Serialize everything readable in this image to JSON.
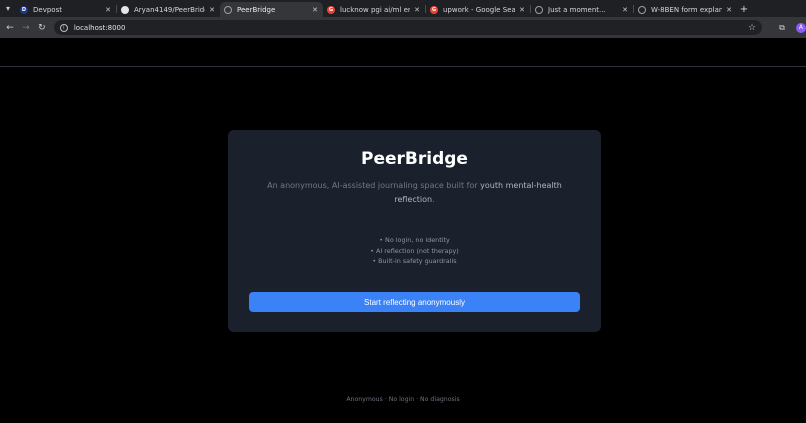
{
  "browser": {
    "tabs": [
      {
        "title": "Devpost",
        "favicon_letter": "D",
        "favicon_color": "#1e3a8a"
      },
      {
        "title": "Aryan4149/PeerBridge",
        "favicon_letter": "",
        "favicon_color": "#e5e5e5"
      },
      {
        "title": "PeerBridge",
        "favicon_letter": "",
        "favicon_color": "#9aa0a6"
      },
      {
        "title": "lucknow pgi ai/ml engi",
        "favicon_letter": "G",
        "favicon_color": "#ea4335"
      },
      {
        "title": "upwork - Google Search",
        "favicon_letter": "G",
        "favicon_color": "#ea4335"
      },
      {
        "title": "Just a moment...",
        "favicon_letter": "",
        "favicon_color": "#9aa0a6"
      },
      {
        "title": "W-8BEN form explanati",
        "favicon_letter": "",
        "favicon_color": "#9aa0a6"
      }
    ],
    "url": "localhost:8000",
    "profile_initial": "A"
  },
  "app": {
    "title": "PeerBridge",
    "description_lead": "An anonymous, AI-assisted journaling space built for ",
    "description_highlight": "youth mental-health reflection",
    "description_end": ".",
    "features": [
      "• No login, no identity",
      "• AI reflection (not therapy)",
      "• Built-in safety guardrails"
    ],
    "cta_label": "Start reflecting anonymously",
    "footer": "Anonymous · No login · No diagnosis"
  }
}
